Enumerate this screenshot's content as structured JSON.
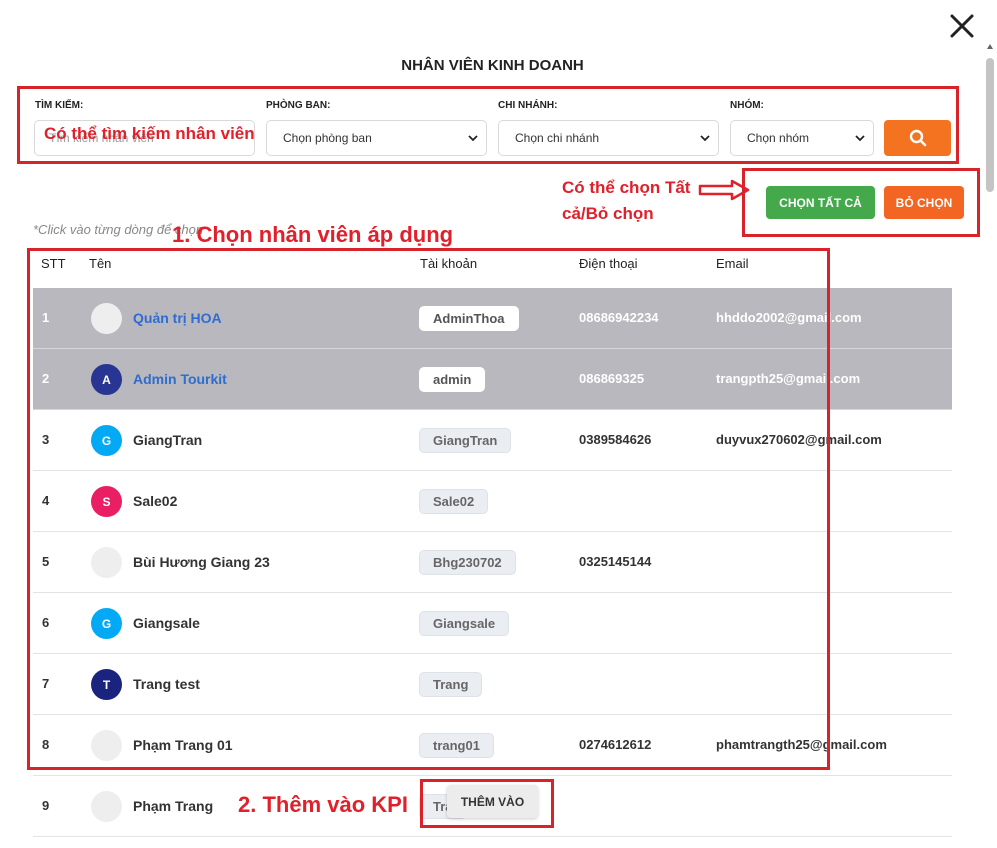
{
  "dialog": {
    "title": "NHÂN VIÊN KINH DOANH",
    "close_icon": "close-icon"
  },
  "filters": {
    "search": {
      "label": "TÌM KIẾM:",
      "placeholder": "Tìm kiếm nhân viên"
    },
    "department": {
      "label": "PHÒNG BAN:",
      "value": "Chọn phòng ban"
    },
    "branch": {
      "label": "CHI NHÁNH:",
      "value": "Chọn chi nhánh"
    },
    "group": {
      "label": "NHÓM:",
      "value": "Chọn nhóm"
    },
    "search_button_icon": "search-icon"
  },
  "actions": {
    "select_all": "CHỌN TẤT CẢ",
    "deselect": "BỎ CHỌN",
    "add": "THÊM VÀO"
  },
  "hint": "*Click vào từng dòng để chọn",
  "table": {
    "headers": {
      "stt": "STT",
      "name": "Tên",
      "account": "Tài khoản",
      "phone": "Điện thoại",
      "email": "Email"
    },
    "rows": [
      {
        "stt": "1",
        "avatar": "",
        "name": "Quản trị HOA",
        "account": "AdminThoa",
        "phone": "08686942234",
        "email": "hhddo2002@gmail.com",
        "selected": true
      },
      {
        "stt": "2",
        "avatar": "A",
        "name": "Admin Tourkit",
        "account": "admin",
        "phone": "086869325",
        "email": "trangpth25@gmail.com",
        "selected": true
      },
      {
        "stt": "3",
        "avatar": "G",
        "name": "GiangTran",
        "account": "GiangTran",
        "phone": "0389584626",
        "email": "duyvux270602@gmail.com",
        "selected": false
      },
      {
        "stt": "4",
        "avatar": "S",
        "name": "Sale02",
        "account": "Sale02",
        "phone": "",
        "email": "",
        "selected": false
      },
      {
        "stt": "5",
        "avatar": "",
        "name": "Bùi Hương Giang 23",
        "account": "Bhg230702",
        "phone": "0325145144",
        "email": "",
        "selected": false
      },
      {
        "stt": "6",
        "avatar": "G",
        "name": "Giangsale",
        "account": "Giangsale",
        "phone": "",
        "email": "",
        "selected": false
      },
      {
        "stt": "7",
        "avatar": "T",
        "name": "Trang test",
        "account": "Trang",
        "phone": "",
        "email": "",
        "selected": false
      },
      {
        "stt": "8",
        "avatar": "",
        "name": "Phạm Trang 01",
        "account": "trang01",
        "phone": "0274612612",
        "email": "phamtrangth25@gmail.com",
        "selected": false
      },
      {
        "stt": "9",
        "avatar": "",
        "name": "Phạm Trang",
        "account": "Tra",
        "phone": "",
        "email": "",
        "selected": false
      }
    ]
  },
  "annotations": {
    "search_note": "Có thể tìm kiếm nhân viên",
    "select_note_line1": "Có thể chọn Tất",
    "select_note_line2": "cả/Bỏ chọn",
    "step1": "1. Chọn nhân viên áp dụng",
    "step2": "2. Thêm vào KPI"
  },
  "colors": {
    "accent_orange": "#f47321",
    "deselect_orange": "#f26522",
    "select_all_green": "#43a94b",
    "selected_row": "#b8b8be",
    "annotation_red": "#d9232b",
    "avatar_navy": "#283593",
    "avatar_blue": "#03a9f4",
    "avatar_pink": "#e91e63"
  }
}
